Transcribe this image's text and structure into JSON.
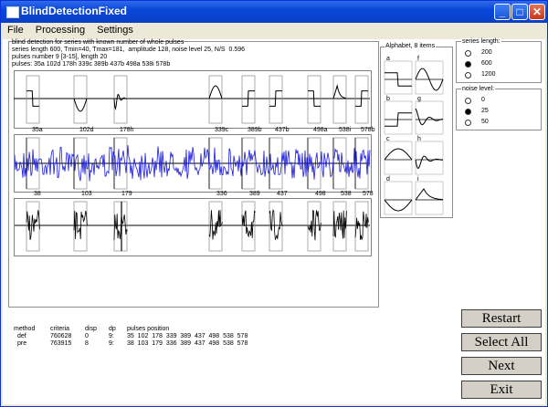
{
  "window": {
    "title": "BlindDetectionFixed"
  },
  "menu": [
    "File",
    "Processing",
    "Settings"
  ],
  "info": {
    "line1": "blind detection for series with known number of whole pulses",
    "line2": "series length 600, Tmin=40, Tmax=181,  amplitude 128, noise level 25, N/S  0.596",
    "line3": "pulses number 9 [3-15], length 20",
    "line4": "pulses: 35a 102d 178h 339c 389b 437b 498a 538i 578b"
  },
  "strip1_labels": [
    "35a",
    "102d",
    "178h",
    "339c",
    "389b",
    "437b",
    "498a",
    "538i",
    "578b"
  ],
  "strip2_labels": [
    "38",
    "103",
    "179",
    "336",
    "389",
    "437",
    "498",
    "538",
    "578"
  ],
  "alphabet": {
    "title": "Alphabet, 8 items",
    "letters": [
      "a",
      "f",
      "b",
      "g",
      "c",
      "h",
      "d",
      "i"
    ]
  },
  "series_length": {
    "title": "series length:",
    "options": [
      "200",
      "600",
      "1200"
    ],
    "selected": 1
  },
  "noise_level": {
    "title": "noise level:",
    "options": [
      "0",
      "25",
      "50"
    ],
    "selected": 1
  },
  "results": {
    "headers": [
      "method",
      "criteria",
      "disp",
      "dp",
      "pulses position"
    ],
    "rows": [
      [
        "def",
        "760628",
        "0",
        "9:",
        "35  102  178  339  389  437  498  538  578"
      ],
      [
        "pre",
        "763915",
        "8",
        "9:",
        "38  103  179  336  389  437  498  538  578"
      ]
    ]
  },
  "buttons": {
    "restart": "Restart",
    "select_all": "Select All",
    "next": "Next",
    "exit": "Exit"
  }
}
